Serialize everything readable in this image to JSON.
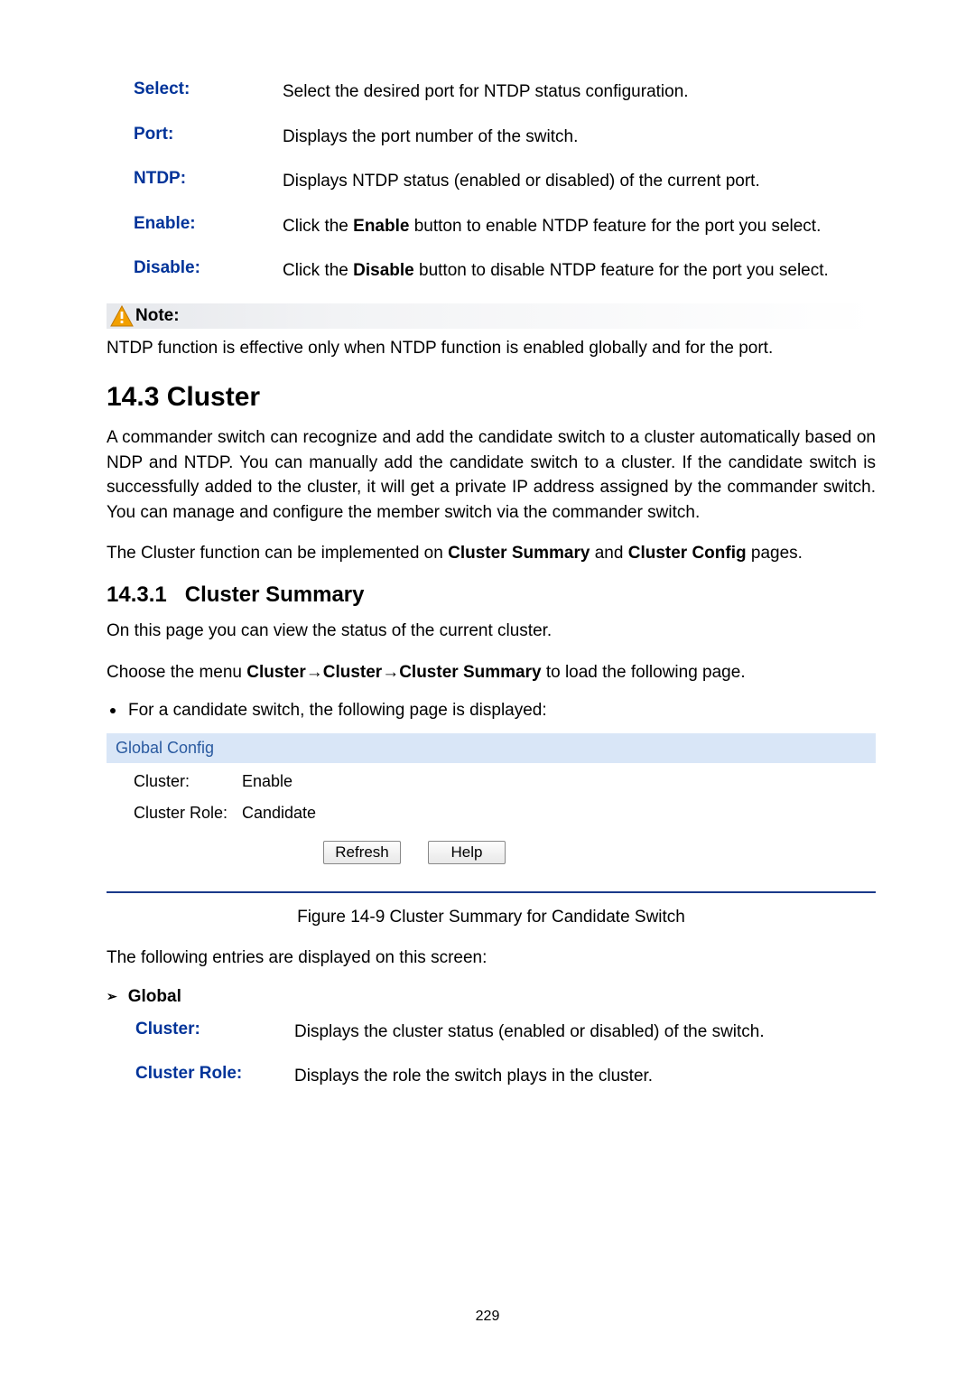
{
  "defs": {
    "select": {
      "label": "Select:",
      "desc": "Select the desired port for NTDP status configuration."
    },
    "port": {
      "label": "Port:",
      "desc": "Displays the port number of the switch."
    },
    "ntdp": {
      "label": "NTDP:",
      "desc": "Displays NTDP status (enabled or disabled) of the current port."
    },
    "enable": {
      "label": "Enable:",
      "desc_pre": "Click the ",
      "desc_bold": "Enable",
      "desc_post": " button to enable NTDP feature for the port you select."
    },
    "disable": {
      "label": "Disable:",
      "desc_pre": "Click the ",
      "desc_bold": "Disable",
      "desc_post": " button to disable NTDP feature for the port you select."
    }
  },
  "note": {
    "label": "Note:",
    "text": "NTDP function is effective only when NTDP function is enabled globally and for the port."
  },
  "section": {
    "number": "14.3",
    "title": "Cluster",
    "para1": "A commander switch can recognize and add the candidate switch to a cluster automatically based on NDP and NTDP. You can manually add the candidate switch to a cluster. If the candidate switch is successfully added to the cluster, it will get a private IP address assigned by the commander switch. You can manage and configure the member switch via the commander switch.",
    "para2_pre": "The Cluster function can be implemented on ",
    "para2_b1": "Cluster Summary",
    "para2_mid": " and ",
    "para2_b2": "Cluster Config",
    "para2_post": " pages."
  },
  "subsection": {
    "number": "14.3.1",
    "title": "Cluster Summary",
    "para1": "On this page you can view the status of the current cluster.",
    "menu_pre": "Choose the menu ",
    "menu_b1": "Cluster",
    "menu_arrow": "→",
    "menu_b2": "Cluster",
    "menu_b3": "Cluster Summary",
    "menu_post": " to load the following page.",
    "bullet": "For a candidate switch, the following page is displayed:"
  },
  "ui": {
    "title": "Global Config",
    "row1_label": "Cluster:",
    "row1_value": "Enable",
    "row2_label": "Cluster Role:",
    "row2_value": "Candidate",
    "btn_refresh": "Refresh",
    "btn_help": "Help"
  },
  "figcap": "Figure 14-9 Cluster Summary for Candidate Switch",
  "entries_intro": "The following entries are displayed on this screen:",
  "global_heading": "Global",
  "defs2": {
    "cluster": {
      "label": "Cluster:",
      "desc": "Displays the cluster status (enabled or disabled) of the switch."
    },
    "role": {
      "label": "Cluster Role:",
      "desc": "Displays the role the switch plays in the cluster."
    }
  },
  "pagenum": "229"
}
